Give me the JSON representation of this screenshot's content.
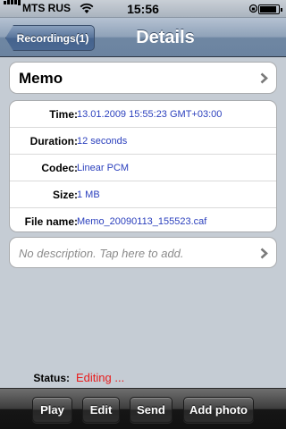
{
  "status_bar": {
    "carrier": "MTS RUS",
    "time": "15:56",
    "signal_icon": "signal-bars-icon",
    "wifi_icon": "wifi-icon",
    "lock_icon": "orientation-lock-icon",
    "battery_level": 0.9
  },
  "nav": {
    "back_label": "Recordings(1)",
    "title": "Details"
  },
  "memo": {
    "title": "Memo"
  },
  "details": {
    "rows": [
      {
        "label": "Time:",
        "value": "13.01.2009 15:55:23 GMT+03:00"
      },
      {
        "label": "Duration:",
        "value": "12 seconds"
      },
      {
        "label": "Codec:",
        "value": "Linear PCM"
      },
      {
        "label": "Size:",
        "value": "1 MB"
      },
      {
        "label": "File name:",
        "value": "Memo_20090113_155523.caf"
      }
    ]
  },
  "description": {
    "placeholder": "No description.  Tap here to add."
  },
  "status": {
    "label": "Status:",
    "value": "Editing ..."
  },
  "toolbar": {
    "play_label": "Play",
    "edit_label": "Edit",
    "send_label": "Send",
    "add_photo_label": "Add photo"
  },
  "colors": {
    "value_text": "#2a3fbd",
    "status_text": "#e81c1c",
    "background": "#c5ccd4"
  }
}
